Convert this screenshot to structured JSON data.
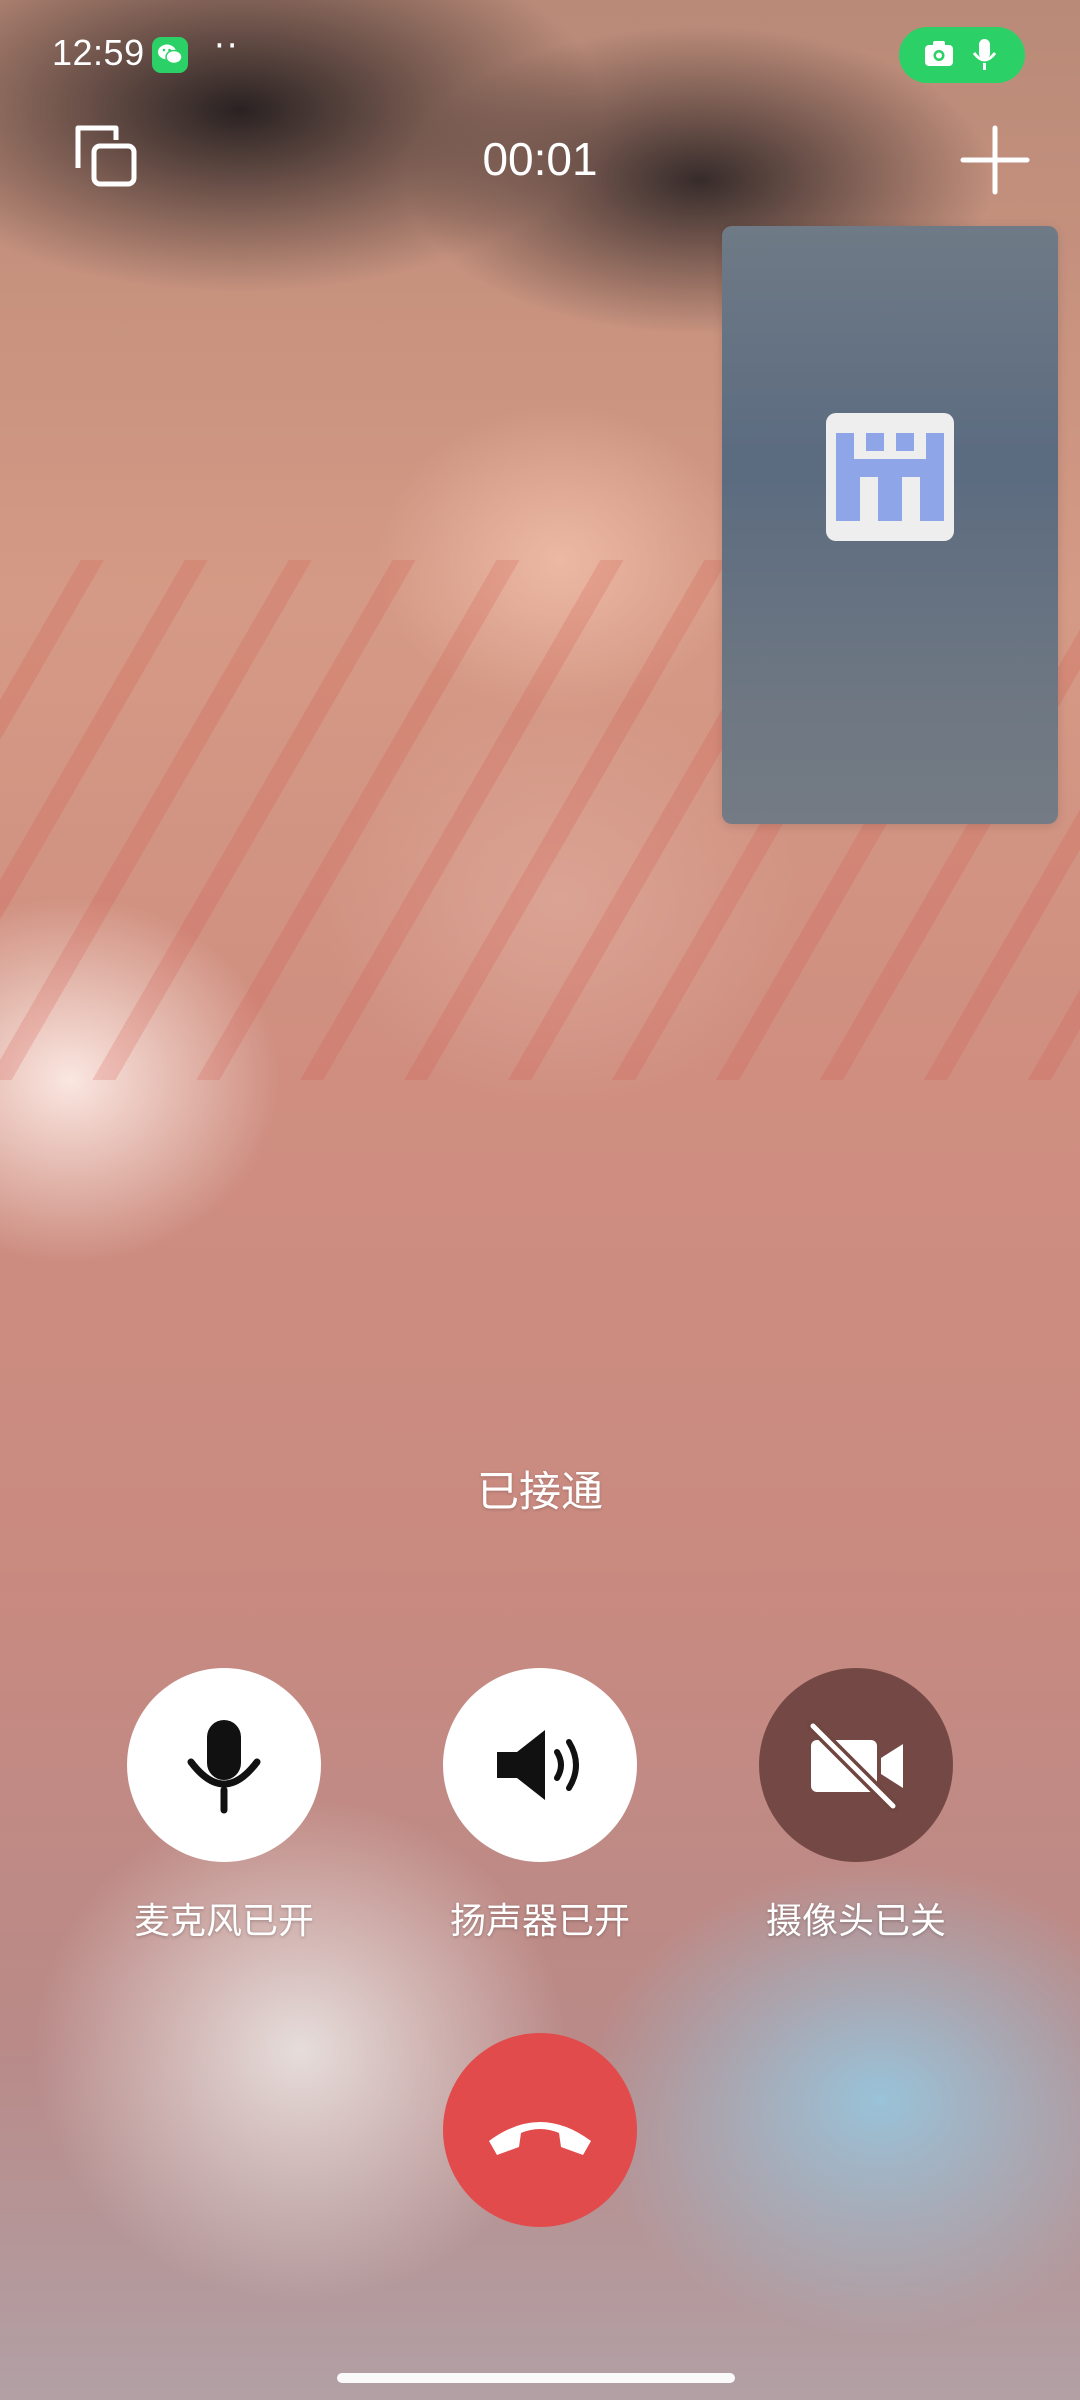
{
  "status_bar": {
    "time": "12:59",
    "dots": "··",
    "app_icon": "wechat-icon",
    "indicator_icons": [
      "camera-icon",
      "microphone-icon"
    ],
    "indicator_color": "#2bd166"
  },
  "call": {
    "timer": "00:01",
    "status": "已接通"
  },
  "top_controls": {
    "left_icon": "switch-window-icon",
    "right_icon": "plus-icon"
  },
  "self_preview": {
    "avatar_icon": "pixel-avatar-icon"
  },
  "controls": {
    "mic_label": "麦克风已开",
    "speaker_label": "扬声器已开",
    "camera_label": "摄像头已关",
    "hangup_icon": "hangup-phone-icon",
    "hangup_color": "#e14b4b"
  }
}
